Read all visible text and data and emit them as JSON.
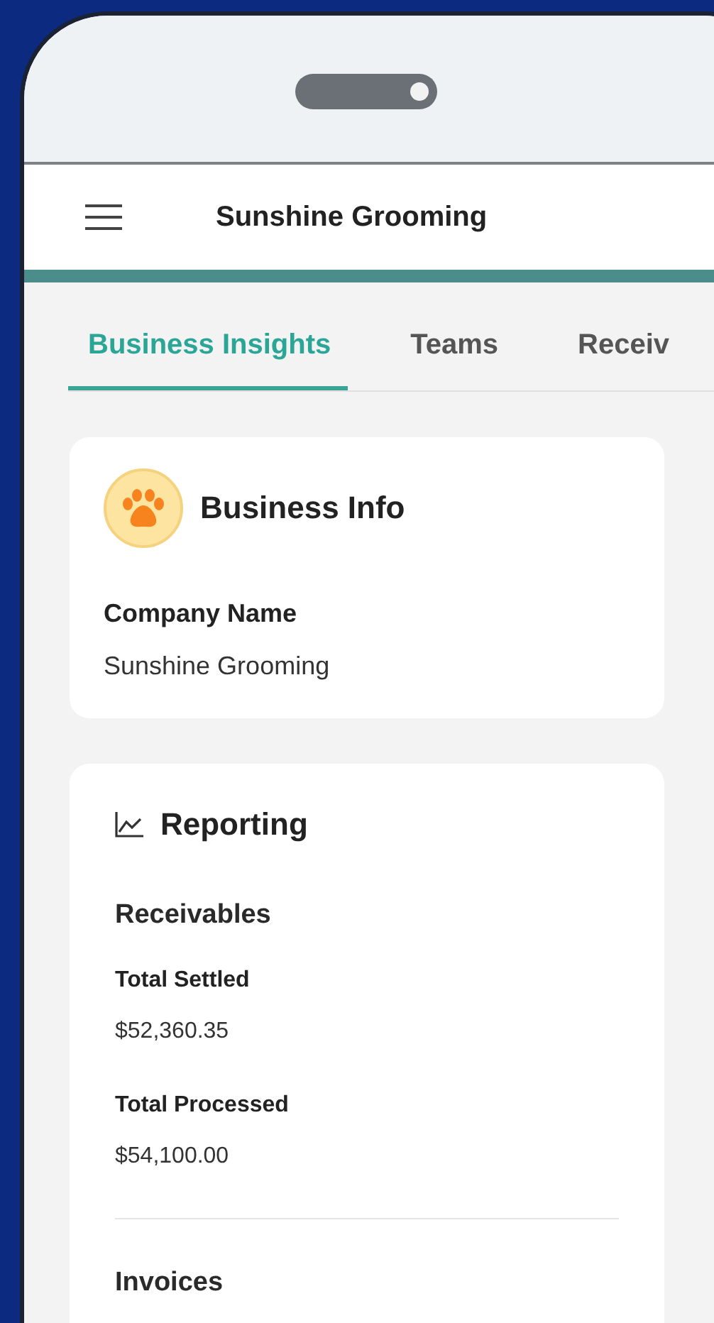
{
  "app_bar": {
    "title": "Sunshine Grooming"
  },
  "tabs": [
    {
      "label": "Business Insights",
      "selected": true
    },
    {
      "label": "Teams",
      "selected": false
    },
    {
      "label": "Receiv",
      "selected": false
    }
  ],
  "business_info": {
    "title": "Business Info",
    "fields": [
      {
        "label": "Company Name",
        "value": "Sunshine Grooming"
      }
    ]
  },
  "reporting": {
    "title": "Reporting",
    "sections": [
      {
        "title": "Receivables",
        "metrics": [
          {
            "label": "Total Settled",
            "value": "$52,360.35"
          },
          {
            "label": "Total Processed",
            "value": "$54,100.00"
          }
        ]
      },
      {
        "title": "Invoices"
      }
    ]
  }
}
